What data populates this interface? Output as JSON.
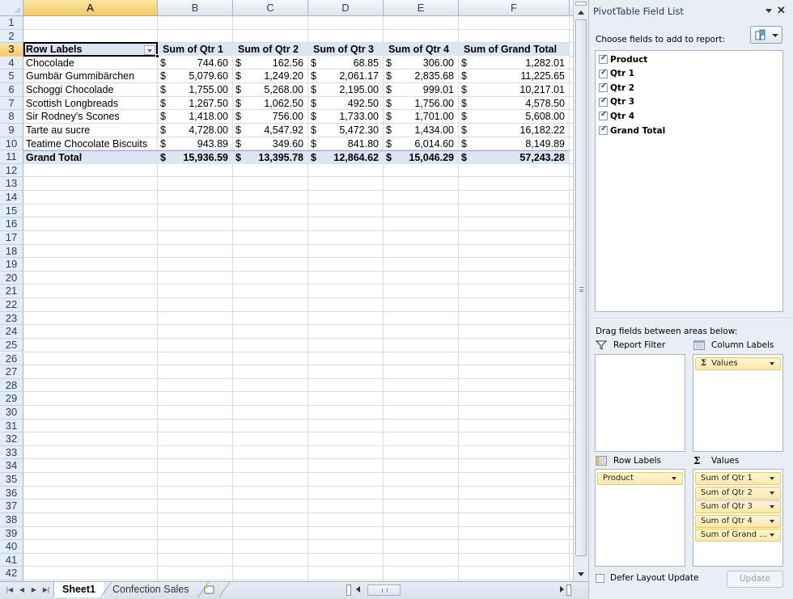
{
  "spreadsheet": {
    "columns": [
      "A",
      "B",
      "C",
      "D",
      "E",
      "F"
    ],
    "active_column": "A",
    "active_row": 3,
    "row_numbers": [
      1,
      2,
      3,
      4,
      5,
      6,
      7,
      8,
      9,
      10,
      11,
      12,
      13,
      14,
      15,
      16,
      17,
      18,
      19,
      20,
      21,
      22,
      23,
      24,
      25,
      26,
      27,
      28,
      29,
      30,
      31,
      32,
      33,
      34,
      35,
      36,
      37,
      38,
      39,
      40,
      41,
      42
    ],
    "pivot": {
      "row_labels_header": "Row Labels",
      "value_headers": [
        "Sum of Qtr 1",
        "Sum of Qtr 2",
        "Sum of Qtr 3",
        "Sum of Qtr 4",
        "Sum of Grand Total"
      ],
      "currency_symbol": "$",
      "rows": [
        {
          "label": "Chocolade",
          "values": [
            "744.60",
            "162.56",
            "68.85",
            "306.00",
            "1,282.01"
          ]
        },
        {
          "label": "Gumbär Gummibärchen",
          "values": [
            "5,079.60",
            "1,249.20",
            "2,061.17",
            "2,835.68",
            "11,225.65"
          ]
        },
        {
          "label": "Schoggi Chocolade",
          "values": [
            "1,755.00",
            "5,268.00",
            "2,195.00",
            "999.01",
            "10,217.01"
          ]
        },
        {
          "label": "Scottish Longbreads",
          "values": [
            "1,267.50",
            "1,062.50",
            "492.50",
            "1,756.00",
            "4,578.50"
          ]
        },
        {
          "label": "Sir Rodney's Scones",
          "values": [
            "1,418.00",
            "756.00",
            "1,733.00",
            "1,701.00",
            "5,608.00"
          ]
        },
        {
          "label": "Tarte au sucre",
          "values": [
            "4,728.00",
            "4,547.92",
            "5,472.30",
            "1,434.00",
            "16,182.22"
          ]
        },
        {
          "label": "Teatime Chocolate Biscuits",
          "values": [
            "943.89",
            "349.60",
            "841.80",
            "6,014.60",
            "8,149.89"
          ]
        }
      ],
      "grand_total": {
        "label": "Grand Total",
        "values": [
          "15,936.59",
          "13,395.78",
          "12,864.62",
          "15,046.29",
          "57,243.28"
        ]
      }
    }
  },
  "sheet_tabs": {
    "tabs": [
      "Sheet1",
      "Confection Sales"
    ],
    "active": "Sheet1",
    "nav_icons": [
      "first-sheet-icon",
      "prev-sheet-icon",
      "next-sheet-icon",
      "last-sheet-icon"
    ],
    "nav_glyphs": [
      "|◀",
      "◀",
      "▶",
      "▶|"
    ]
  },
  "field_list": {
    "title": "PivotTable Field List",
    "choose_label": "Choose fields to add to report:",
    "fields": [
      {
        "name": "Product",
        "checked": true
      },
      {
        "name": "Qtr 1",
        "checked": true
      },
      {
        "name": "Qtr 2",
        "checked": true
      },
      {
        "name": "Qtr 3",
        "checked": true
      },
      {
        "name": "Qtr 4",
        "checked": true
      },
      {
        "name": "Grand Total",
        "checked": true
      }
    ],
    "drag_label": "Drag fields between areas below:",
    "areas": {
      "report_filter": {
        "title": "Report Filter",
        "items": []
      },
      "column_labels": {
        "title": "Column Labels",
        "items": [
          "Values"
        ]
      },
      "row_labels": {
        "title": "Row Labels",
        "items": [
          "Product"
        ]
      },
      "values": {
        "title": "Values",
        "items": [
          "Sum of Qtr 1",
          "Sum of Qtr 2",
          "Sum of Qtr 3",
          "Sum of Qtr 4",
          "Sum of Grand ..."
        ]
      }
    },
    "defer_label": "Defer Layout Update",
    "defer_checked": false,
    "update_label": "Update",
    "sigma": "Σ"
  }
}
